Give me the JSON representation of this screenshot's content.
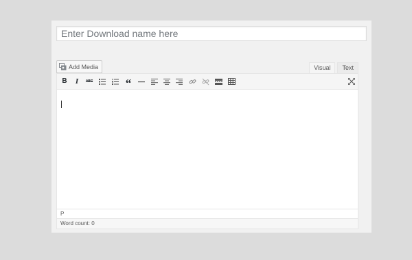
{
  "title_field": {
    "placeholder": "Enter Download name here",
    "value": ""
  },
  "media": {
    "add_media_label": "Add Media"
  },
  "editor_tabs": {
    "visual": "Visual",
    "text": "Text",
    "active": "Visual"
  },
  "toolbar": {
    "bold_glyph": "B",
    "italic_glyph": "I",
    "strikethrough_glyph": "ABC",
    "blockquote_glyph": "“",
    "buttons": [
      "bold",
      "italic",
      "strikethrough",
      "bulleted-list",
      "numbered-list",
      "blockquote",
      "horizontal-line",
      "align-left",
      "align-center",
      "align-right",
      "insert-link",
      "remove-link",
      "read-more",
      "toolbar-toggle",
      "fullscreen"
    ]
  },
  "content": {
    "text": ""
  },
  "status": {
    "path": "P",
    "word_count": "Word count: 0"
  },
  "colors": {
    "page_bg": "#dcdcdc",
    "panel_bg": "#f1f1f1",
    "icon": "#555555"
  }
}
